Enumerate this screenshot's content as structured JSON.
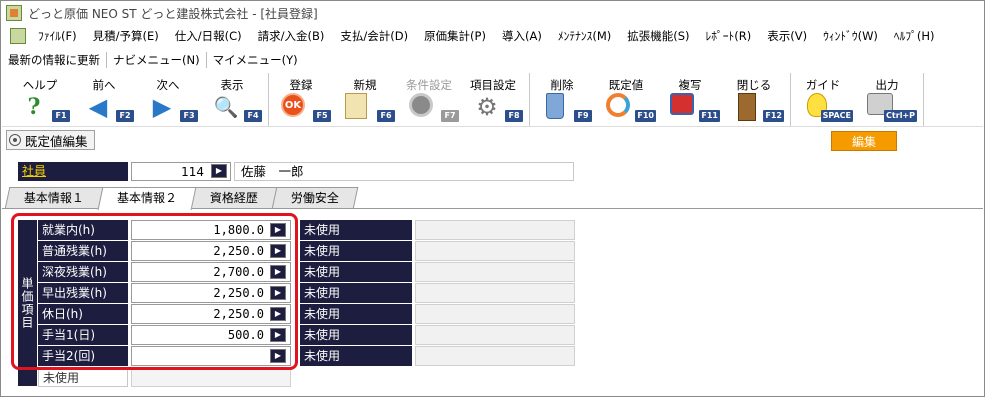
{
  "window": {
    "title": "どっと原価 NEO ST どっと建設株式会社 - [社員登録]"
  },
  "menu": [
    "ﾌｧｲﾙ(F)",
    "見積/予算(E)",
    "仕入/日報(C)",
    "請求/入金(B)",
    "支払/会計(D)",
    "原価集計(P)",
    "導入(A)",
    "ﾒﾝﾃﾅﾝｽ(M)",
    "拡張機能(S)",
    "ﾚﾎﾟｰﾄ(R)",
    "表示(V)",
    "ｳｨﾝﾄﾞｳ(W)",
    "ﾍﾙﾌﾟ(H)"
  ],
  "subbar": [
    "最新の情報に更新",
    "ナビメニュー(N)",
    "マイメニュー(Y)"
  ],
  "toolbar": [
    {
      "label": "ヘルプ",
      "key": "F1",
      "icon": "help-icon",
      "glyph": "?",
      "enabled": true
    },
    {
      "label": "前へ",
      "key": "F2",
      "icon": "arrow-left-icon",
      "glyph": "◀",
      "enabled": true
    },
    {
      "label": "次へ",
      "key": "F3",
      "icon": "arrow-right-icon",
      "glyph": "▶",
      "enabled": true
    },
    {
      "label": "表示",
      "key": "F4",
      "icon": "magnifier-icon",
      "glyph": "🔍",
      "enabled": true
    },
    {
      "label": "登録",
      "key": "F5",
      "icon": "ok-icon",
      "glyph": "OK",
      "enabled": true
    },
    {
      "label": "新規",
      "key": "F6",
      "icon": "new-document-icon",
      "glyph": "",
      "enabled": true
    },
    {
      "label": "条件設定",
      "key": "F7",
      "icon": "condition-icon",
      "glyph": "",
      "enabled": false
    },
    {
      "label": "項目設定",
      "key": "F8",
      "icon": "gears-icon",
      "glyph": "⚙",
      "enabled": true
    },
    {
      "label": "削除",
      "key": "F9",
      "icon": "trash-icon",
      "glyph": "",
      "enabled": true
    },
    {
      "label": "既定値",
      "key": "F10",
      "icon": "refresh-icon",
      "glyph": "",
      "enabled": true
    },
    {
      "label": "複写",
      "key": "F11",
      "icon": "copy-icon",
      "glyph": "",
      "enabled": true
    },
    {
      "label": "閉じる",
      "key": "F12",
      "icon": "door-icon",
      "glyph": "",
      "enabled": true
    },
    {
      "label": "ガイド",
      "key": "SPACE",
      "icon": "lightbulb-icon",
      "glyph": "",
      "enabled": true
    },
    {
      "label": "出力",
      "key": "Ctrl+P",
      "icon": "printer-icon",
      "glyph": "",
      "enabled": true
    }
  ],
  "section": {
    "title": "既定値編集",
    "badge": "編集"
  },
  "employee": {
    "label": "社員",
    "code": "114",
    "name": "佐藤　一郎"
  },
  "tabs": [
    "基本情報１",
    "基本情報２",
    "資格経歴",
    "労働安全"
  ],
  "active_tab": "基本情報２",
  "group_label": "単価項目",
  "rows": [
    {
      "label": "就業内(h)",
      "value": "1,800.0"
    },
    {
      "label": "普通残業(h)",
      "value": "2,250.0"
    },
    {
      "label": "深夜残業(h)",
      "value": "2,700.0"
    },
    {
      "label": "早出残業(h)",
      "value": "2,250.0"
    },
    {
      "label": "休日(h)",
      "value": "2,250.0"
    },
    {
      "label": "手当1(日)",
      "value": "500.0"
    },
    {
      "label": "手当2(回)",
      "value": ""
    },
    {
      "label": "未使用",
      "value": ""
    }
  ],
  "right_rows": [
    "未使用",
    "未使用",
    "未使用",
    "未使用",
    "未使用",
    "未使用",
    "未使用"
  ],
  "colors": {
    "header_navy": "#1d1d3f",
    "badge_orange": "#f59b00",
    "highlight_red": "#e0141e",
    "fkey_blue": "#2c4f8c"
  }
}
